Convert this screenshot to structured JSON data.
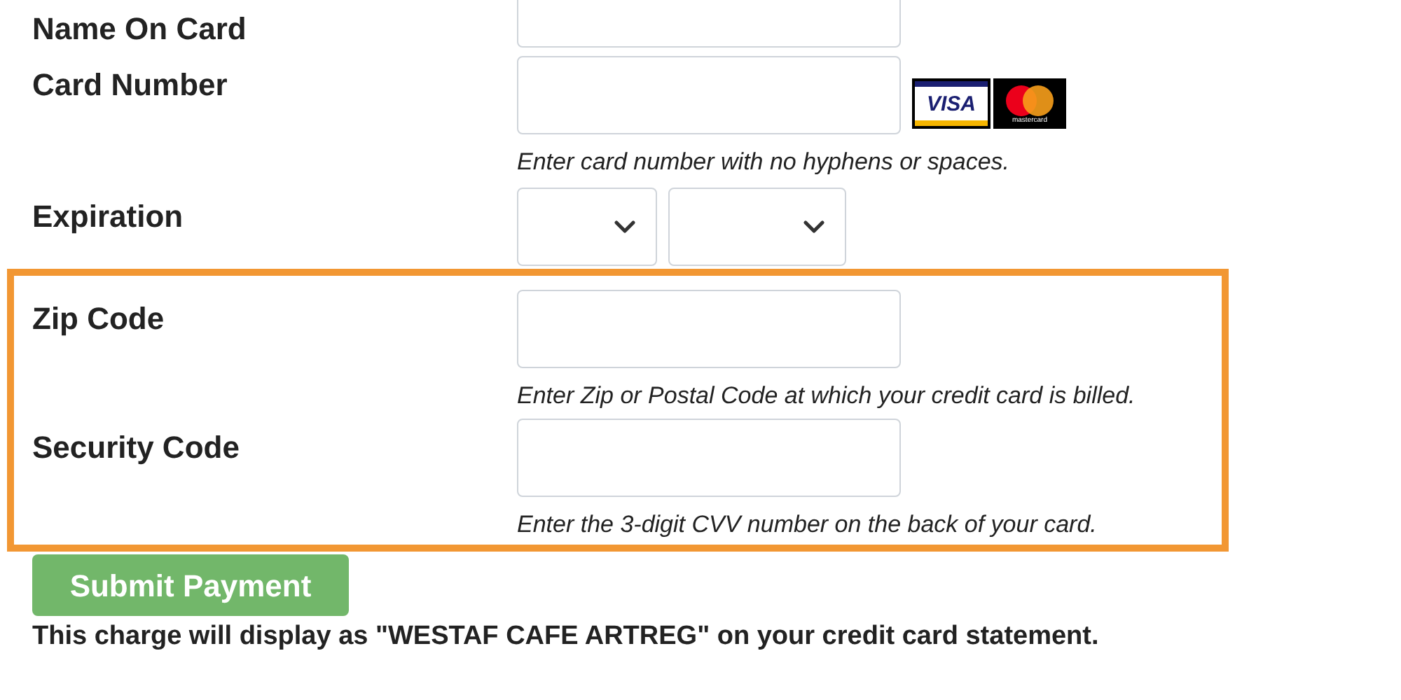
{
  "fields": [
    {
      "label": "Name On Card",
      "kind": "text"
    },
    {
      "label": "Card Number",
      "kind": "text",
      "logos": [
        "VISA",
        "mastercard"
      ],
      "hint": "Enter card number with no hyphens or spaces."
    },
    {
      "label": "Expiration",
      "kind": "selects"
    }
  ],
  "highlighted_fields": [
    {
      "label": "Zip Code",
      "kind": "text",
      "hint": "Enter Zip or Postal Code at which your credit card is billed."
    },
    {
      "label": "Security Code",
      "kind": "text",
      "hint": "Enter the 3-digit CVV number on the back of your card."
    }
  ],
  "submit_button": "Submit Payment",
  "note": "This charge will display as \"WESTAF CAFE ARTREG\" on your credit card statement."
}
